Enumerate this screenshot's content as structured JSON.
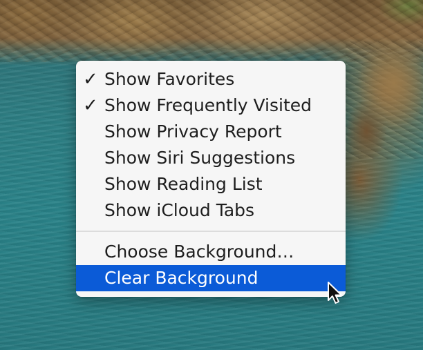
{
  "menu": {
    "group1": [
      {
        "label": "Show Favorites",
        "checked": true
      },
      {
        "label": "Show Frequently Visited",
        "checked": true
      },
      {
        "label": "Show Privacy Report",
        "checked": false
      },
      {
        "label": "Show Siri Suggestions",
        "checked": false
      },
      {
        "label": "Show Reading List",
        "checked": false
      },
      {
        "label": "Show iCloud Tabs",
        "checked": false
      }
    ],
    "group2": [
      {
        "label": "Choose Background…",
        "selected": false
      },
      {
        "label": "Clear Background",
        "selected": true
      }
    ],
    "check_glyph": "✓",
    "highlight_color": "#0b5bd7"
  },
  "cursor": {
    "icon": "arrow-pointer-icon"
  }
}
